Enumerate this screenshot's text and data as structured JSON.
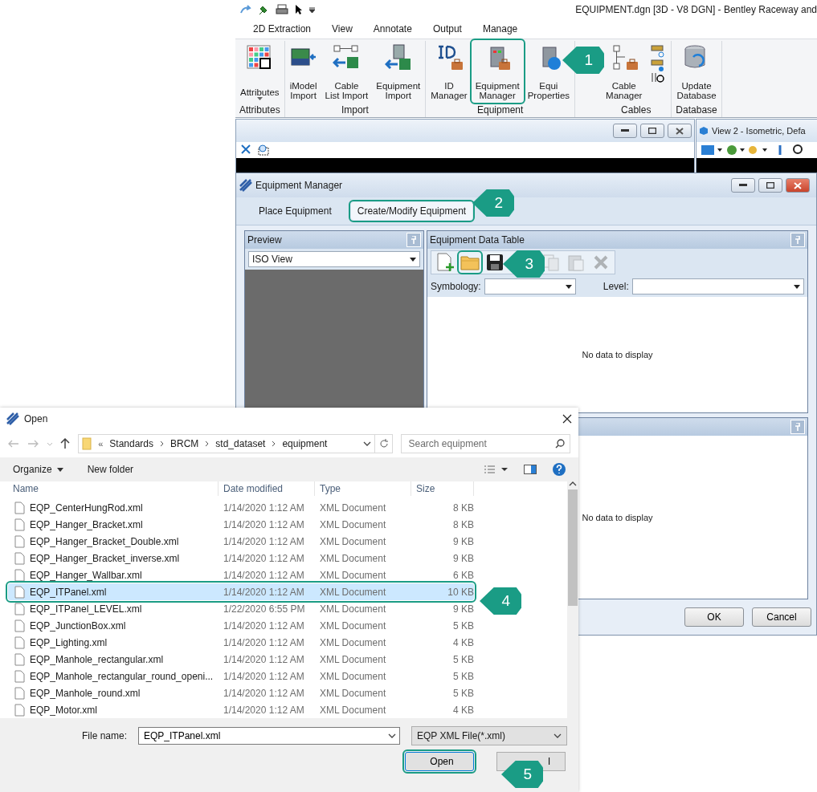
{
  "app_window": {
    "title": "EQUIPMENT.dgn [3D - V8 DGN] - Bentley Raceway and",
    "tabs": [
      {
        "label": "2D Extraction",
        "selected": false
      },
      {
        "label": "View",
        "selected": false
      },
      {
        "label": "Annotate",
        "selected": false
      },
      {
        "label": "Output",
        "selected": false
      },
      {
        "label": "Manage",
        "selected": false
      }
    ],
    "ribbon_groups": [
      {
        "label": "Attributes",
        "buttons": [
          {
            "kind": "attributes",
            "lines": [
              "Attributes"
            ],
            "dropdown": true,
            "highlighted": false
          }
        ]
      },
      {
        "label": "Import",
        "buttons": [
          {
            "kind": "imodel",
            "lines": [
              "iModel",
              "Import"
            ],
            "highlighted": false
          },
          {
            "kind": "cable-import",
            "lines": [
              "Cable",
              "List Import"
            ],
            "highlighted": false
          },
          {
            "kind": "equipment-import",
            "lines": [
              "Equipment",
              "Import"
            ],
            "highlighted": false
          }
        ]
      },
      {
        "label": "Equipment",
        "buttons": [
          {
            "kind": "id",
            "lines": [
              "ID",
              "Manager"
            ],
            "highlighted": false
          },
          {
            "kind": "equipment",
            "lines": [
              "Equipment",
              "Manager"
            ],
            "highlighted": true
          },
          {
            "kind": "properties",
            "lines": [
              "Equi",
              "Properties"
            ],
            "highlighted": false
          }
        ]
      },
      {
        "label": "Cables",
        "buttons": [
          {
            "kind": "cable",
            "lines": [
              "Cable",
              "Manager"
            ],
            "highlighted": false
          },
          {
            "kind": "small-stack",
            "highlighted": false
          }
        ]
      },
      {
        "label": "Database",
        "buttons": [
          {
            "kind": "database",
            "lines": [
              "Update",
              "Database"
            ],
            "highlighted": false
          }
        ]
      }
    ]
  },
  "view_window": {
    "title": "View 2 - Isometric, Defa"
  },
  "equipment_manager": {
    "title": "Equipment Manager",
    "tabs": [
      {
        "label": "Place Equipment",
        "selected": false,
        "highlighted": false
      },
      {
        "label": "Create/Modify Equipment",
        "selected": true,
        "highlighted": true
      }
    ],
    "preview": {
      "title": "Preview",
      "view_select": "ISO View"
    },
    "data_table": {
      "title": "Equipment Data Table",
      "toolbar": [
        {
          "kind": "new",
          "disabled": false,
          "highlighted": false
        },
        {
          "kind": "open",
          "disabled": false,
          "highlighted": true
        },
        {
          "kind": "save",
          "disabled": false,
          "highlighted": false
        },
        {
          "kind": "copy",
          "disabled": true,
          "highlighted": false
        },
        {
          "kind": "paste",
          "disabled": true,
          "highlighted": false
        },
        {
          "kind": "delete",
          "disabled": true,
          "highlighted": false
        }
      ],
      "symbology_label": "Symbology:",
      "level_label": "Level:",
      "empty": "No data to display"
    },
    "lower_panel": {
      "empty": "No data to display"
    },
    "buttons": [
      "OK",
      "Cancel"
    ]
  },
  "open_dialog": {
    "title": "Open",
    "path_prefix": "«",
    "path": [
      "Standards",
      "BRCM",
      "std_dataset",
      "equipment"
    ],
    "search": {
      "placeholder": "Search equipment"
    },
    "organize": "Organize",
    "new_folder": "New folder",
    "columns": [
      "Name",
      "Date modified",
      "Type",
      "Size"
    ],
    "rows": [
      {
        "name": "EQP_CenterHungRod.xml",
        "date": "1/14/2020 1:12 AM",
        "type": "XML Document",
        "size": "8 KB",
        "selected": false
      },
      {
        "name": "EQP_Hanger_Bracket.xml",
        "date": "1/14/2020 1:12 AM",
        "type": "XML Document",
        "size": "8 KB",
        "selected": false
      },
      {
        "name": "EQP_Hanger_Bracket_Double.xml",
        "date": "1/14/2020 1:12 AM",
        "type": "XML Document",
        "size": "9 KB",
        "selected": false
      },
      {
        "name": "EQP_Hanger_Bracket_inverse.xml",
        "date": "1/14/2020 1:12 AM",
        "type": "XML Document",
        "size": "9 KB",
        "selected": false
      },
      {
        "name": "EQP_Hanger_Wallbar.xml",
        "date": "1/14/2020 1:12 AM",
        "type": "XML Document",
        "size": "6 KB",
        "selected": false
      },
      {
        "name": "EQP_ITPanel.xml",
        "date": "1/14/2020 1:12 AM",
        "type": "XML Document",
        "size": "10 KB",
        "selected": true
      },
      {
        "name": "EQP_ITPanel_LEVEL.xml",
        "date": "1/22/2020 6:55 PM",
        "type": "XML Document",
        "size": "9 KB",
        "selected": false
      },
      {
        "name": "EQP_JunctionBox.xml",
        "date": "1/14/2020 1:12 AM",
        "type": "XML Document",
        "size": "5 KB",
        "selected": false
      },
      {
        "name": "EQP_Lighting.xml",
        "date": "1/14/2020 1:12 AM",
        "type": "XML Document",
        "size": "4 KB",
        "selected": false
      },
      {
        "name": "EQP_Manhole_rectangular.xml",
        "date": "1/14/2020 1:12 AM",
        "type": "XML Document",
        "size": "5 KB",
        "selected": false
      },
      {
        "name": "EQP_Manhole_rectangular_round_openi...",
        "date": "1/14/2020 1:12 AM",
        "type": "XML Document",
        "size": "5 KB",
        "selected": false
      },
      {
        "name": "EQP_Manhole_round.xml",
        "date": "1/14/2020 1:12 AM",
        "type": "XML Document",
        "size": "5 KB",
        "selected": false
      },
      {
        "name": "EQP_Motor.xml",
        "date": "1/14/2020 1:12 AM",
        "type": "XML Document",
        "size": "4 KB",
        "selected": false
      }
    ],
    "file_name_label": "File name:",
    "file_name": "EQP_ITPanel.xml",
    "file_type": "EQP XML File(*.xml)",
    "open_button": {
      "label": "Open",
      "highlighted": true
    },
    "cancel_button": {
      "label": "l"
    }
  },
  "callouts": [
    "1",
    "2",
    "3",
    "4",
    "5"
  ]
}
